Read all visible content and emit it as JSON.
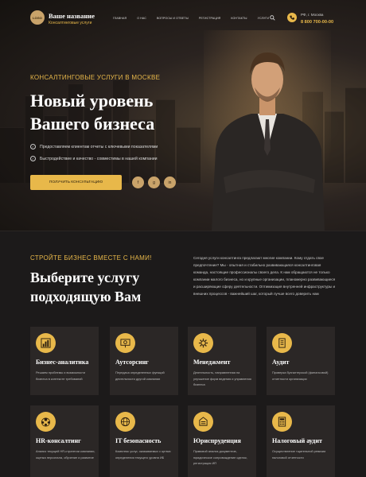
{
  "header": {
    "logo_text": "LOGO",
    "brand_name": "Ваше название",
    "brand_sub": "Консалтинговые услуги",
    "nav": [
      "ГЛАВНАЯ",
      "О НАС",
      "ВОПРОСЫ И ОТВЕТЫ",
      "РЕГИСТРАЦИЯ",
      "КОНТАКТЫ",
      "УСЛУГИ"
    ],
    "city": "РФ, г. Москва",
    "phone": "8 800 700-00-00"
  },
  "hero": {
    "kicker": "КОНСАЛТИНГОВЫЕ УСЛУГИ В МОСКВЕ",
    "title_line1": "Новый уровень",
    "title_line2": "Вашего бизнеса",
    "bullets": [
      "Предоставляем клиентам отчеты с ключевыми показателями",
      "Быстродействие и качество - совместимы в нашей компании"
    ],
    "cta": "ПОЛУЧИТЬ КОНСУЛЬТАЦИЮ",
    "socials": [
      "f",
      "g",
      "in"
    ]
  },
  "services": {
    "kicker": "СТРОЙТЕ БИЗНЕС ВМЕСТЕ С НАМИ!",
    "title_line1": "Выберите услугу",
    "title_line2": "подходящую Вам",
    "description": "Сегодня услуги консалтинга предлагают многие компании. Кому отдать свое предпочтение? Мы - опытная и стабильно развивающаяся консалтинговая команда, настоящие профессионалы своего дела. К нам обращаются не только компании малого бизнеса, но и крупные организации, планомерно развивающиеся и расширяющие сферу деятельности. Оптимизация внутренней инфраструктуры и внешних процессов - важнейший шаг, который лучше всего доверить нам",
    "cards": [
      {
        "title": "Бизнес-аналитика",
        "text": "Решаем проблемы и возможности бизнеса в контексте требований"
      },
      {
        "title": "Аутсорсинг",
        "text": "Передача определенных функций деятельности другой компании"
      },
      {
        "title": "Менеджмент",
        "text": "Деятельность, направленная на улучшение форм ведения и управления бизнеса"
      },
      {
        "title": "Аудит",
        "text": "Проверка бухгалтерской (финансовой) отчетности организации"
      },
      {
        "title": "HR-консалтинг",
        "text": "Анализ текущей HR-стратегии компании, оценка персонала, обучение и развитие"
      },
      {
        "title": "IT безопасность",
        "text": "Комплекс услуг, оказываемых с целью определения текущего уровня ИБ"
      },
      {
        "title": "Юриспруденция",
        "text": "Правовой анализ документов, юридическое сопровождение сделок, регистрация ИП"
      },
      {
        "title": "Налоговый аудит",
        "text": "Осуществление тщательной ревизии налоговой отчетности"
      }
    ]
  },
  "colors": {
    "accent": "#e8b84a",
    "background": "#1c1a1a",
    "card": "#2b2726"
  }
}
